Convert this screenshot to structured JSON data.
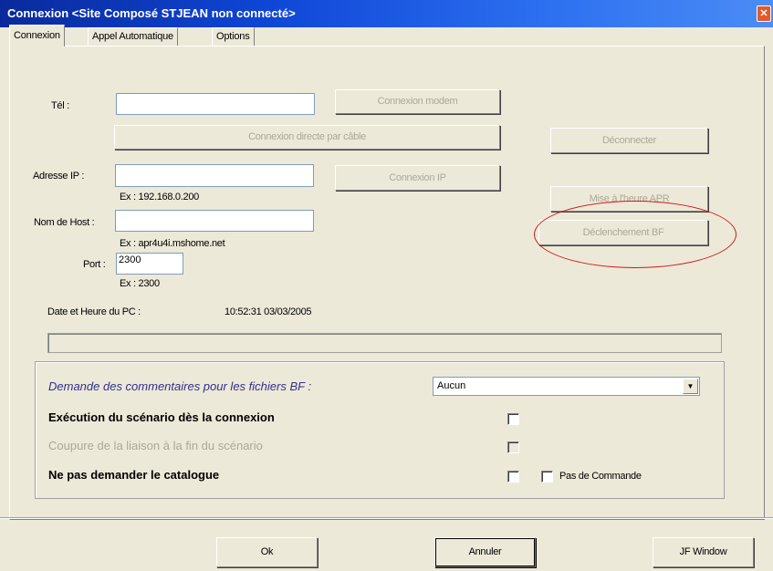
{
  "window": {
    "title": "Connexion <Site Composé STJEAN non connecté>",
    "close_glyph": "✕"
  },
  "tabs": [
    {
      "label": "Connexion",
      "active": true
    },
    {
      "label": "Appel Automatique",
      "active": false
    },
    {
      "label": "Options",
      "active": false
    }
  ],
  "connexion": {
    "tel_label": "Tél :",
    "tel_value": "",
    "modem_button": "Connexion modem",
    "cable_button": "Connexion directe par câble",
    "deconnecter_button": "Déconnecter",
    "ip_label": "Adresse IP :",
    "ip_value": "",
    "ip_hint": "Ex : 192.168.0.200",
    "connexion_ip_button": "Connexion IP",
    "host_label": "Nom de Host :",
    "host_value": "",
    "host_hint": "Ex : apr4u4i.mshome.net",
    "port_label": "Port :",
    "port_value": "2300",
    "port_hint": "Ex : 2300",
    "mise_heure_button": "Mise à l'heure APR",
    "declenchement_button": "Déclenchement BF",
    "date_label": "Date et Heure du PC :",
    "date_value": "10:52:31  03/03/2005"
  },
  "options": {
    "comments_label": "Demande des commentaires pour les fichiers BF :",
    "comments_select": "Aucun",
    "scenario_label": "Exécution du scénario dès la connexion",
    "coupure_label": "Coupure de la liaison à la fin du scénario",
    "catalogue_label": "Ne pas demander le catalogue",
    "pas_commande_label": "Pas de Commande",
    "checkbox_scenario": false,
    "checkbox_coupure": false,
    "checkbox_catalogue": false,
    "checkbox_pas_commande": false
  },
  "footer": {
    "ok_button": "Ok",
    "annuler_button": "Annuler",
    "jf_window_button": "JF Window"
  },
  "colors": {
    "annotation_circle": "#d01818",
    "titlebar": "#0f46d6",
    "dialog_bg": "#ece9d8"
  }
}
